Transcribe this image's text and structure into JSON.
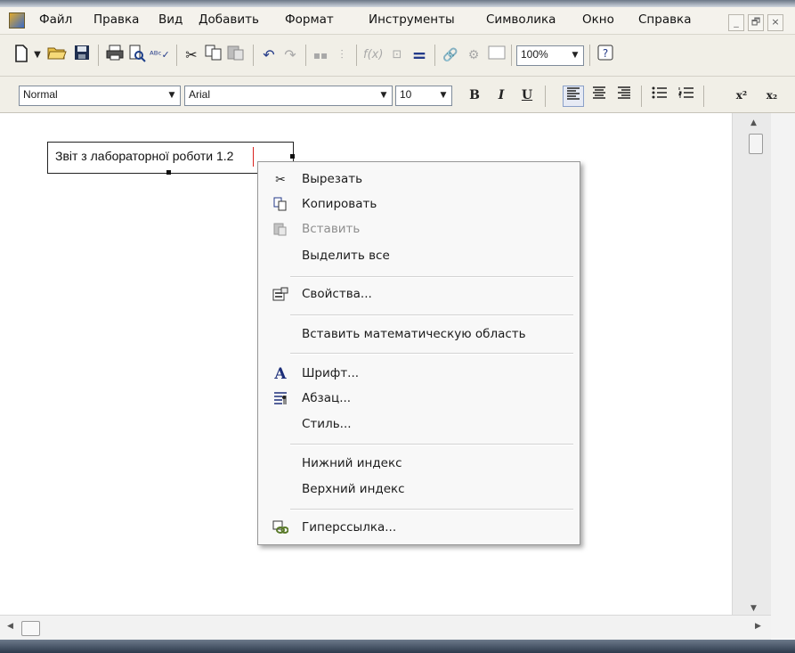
{
  "menubar": {
    "items": [
      "Файл",
      "Правка",
      "Вид",
      "Добавить",
      "Формат",
      "Инструменты",
      "Символика",
      "Окно",
      "Справка"
    ]
  },
  "window_controls": {
    "minimize": "_",
    "restore": "🗗",
    "close": "×"
  },
  "toolbar": {
    "zoom": "100%",
    "icons": [
      "new-document-icon",
      "open-folder-icon",
      "save-icon",
      "print-icon",
      "print-preview-icon",
      "spellcheck-icon",
      "cut-icon",
      "copy-icon",
      "paste-icon",
      "undo-icon",
      "redo-icon",
      "align-icon",
      "align-bottom-icon",
      "insert-function-icon",
      "insert-unit-icon",
      "calculate-icon",
      "hyperlink-icon",
      "component-icon",
      "region-icon",
      "help-icon"
    ]
  },
  "format_bar": {
    "style": "Normal",
    "font": "Arial",
    "size": "10",
    "bold": "B",
    "italic": "I",
    "underline": "U",
    "superscript": "x²",
    "subscript": "x₂"
  },
  "document": {
    "text_region": "Звіт з лабораторної роботи 1.2"
  },
  "context_menu": {
    "items": [
      {
        "label": "Вырезать",
        "icon": "scissors-icon",
        "enabled": true
      },
      {
        "label": "Копировать",
        "icon": "copy-icon",
        "enabled": true
      },
      {
        "label": "Вставить",
        "icon": "paste-icon",
        "enabled": false
      },
      {
        "label": "Выделить все",
        "icon": "",
        "enabled": true
      },
      {
        "label": "Свойства...",
        "icon": "properties-icon",
        "enabled": true
      },
      {
        "label": "Вставить математическую область",
        "icon": "",
        "enabled": true
      },
      {
        "label": "Шрифт...",
        "icon": "font-icon",
        "enabled": true
      },
      {
        "label": "Абзац...",
        "icon": "paragraph-icon",
        "enabled": true
      },
      {
        "label": "Стиль...",
        "icon": "",
        "enabled": true
      },
      {
        "label": "Нижний индекс",
        "icon": "",
        "enabled": true
      },
      {
        "label": "Верхний индекс",
        "icon": "",
        "enabled": true
      },
      {
        "label": "Гиперссылка...",
        "icon": "hyperlink-icon",
        "enabled": true
      }
    ]
  }
}
